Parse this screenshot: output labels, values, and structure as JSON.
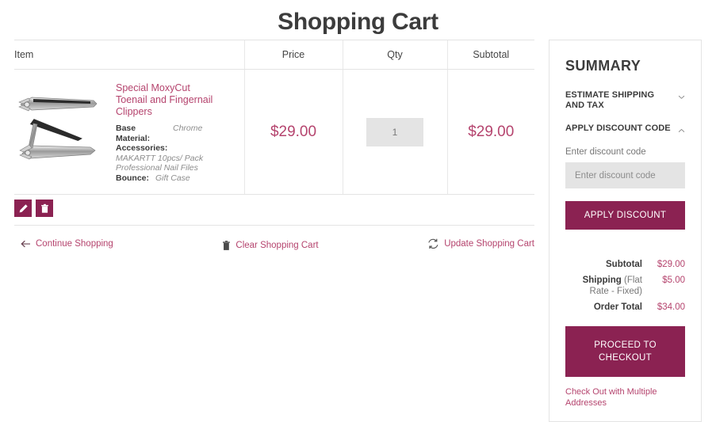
{
  "page": {
    "title": "Shopping Cart"
  },
  "cart": {
    "columns": {
      "item": "Item",
      "price": "Price",
      "qty": "Qty",
      "subtotal": "Subtotal"
    },
    "row": {
      "product_name": "Special MoxyCut Toenail and Fingernail Clippers",
      "product_image_alt": "nail-clippers-image",
      "attributes": [
        {
          "label": "Base Material:",
          "value": "Chrome"
        }
      ],
      "accessories_label": "Accessories:",
      "accessories_value": "MAKARTT 10pcs/ Pack Professional Nail Files",
      "bounce_label": "Bounce:",
      "bounce_value": "Gift Case",
      "price": "$29.00",
      "qty_value": "1",
      "subtotal": "$29.00"
    },
    "actions": {
      "edit_title": "Edit item",
      "delete_title": "Remove item"
    },
    "footer": {
      "continue_shopping": "Continue Shopping",
      "clear_cart": "Clear Shopping Cart",
      "update_cart": "Update Shopping Cart"
    }
  },
  "summary": {
    "title": "SUMMARY",
    "estimate_shipping": "ESTIMATE SHIPPING AND TAX",
    "apply_discount_code": "APPLY DISCOUNT CODE",
    "discount_label": "Enter discount code",
    "discount_placeholder": "Enter discount code",
    "discount_value": "",
    "apply_discount_button": "APPLY DISCOUNT",
    "totals": [
      {
        "label": "Subtotal",
        "note": "",
        "value": "$29.00"
      },
      {
        "label": "Shipping",
        "note": " (Flat Rate - Fixed)",
        "value": "$5.00"
      },
      {
        "label": "Order Total",
        "note": "",
        "value": "$34.00"
      }
    ],
    "proceed_to_checkout": "PROCEED TO CHECKOUT",
    "multiple_addresses": "Check Out with Multiple Addresses"
  },
  "colors": {
    "accent": "#8b2252",
    "link": "#b5446e",
    "text": "#3b3b3b",
    "muted": "#8d8d8d",
    "field_bg": "#e4e4e4",
    "border": "#e4e4e4"
  }
}
